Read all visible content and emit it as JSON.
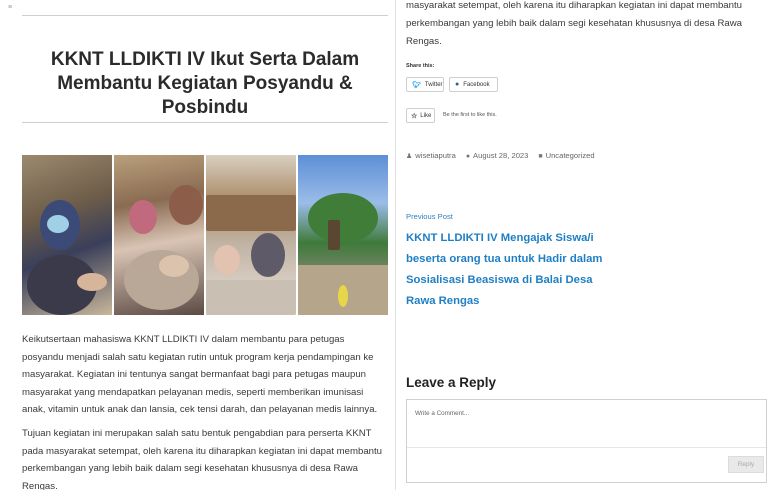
{
  "post": {
    "title": "KKNT LLDIKTI IV Ikut Serta Dalam Membantu Kegiatan Posyandu & Posbindu",
    "paragraph1": "Keikutsertaan mahasiswa KKNT LLDIKTI IV dalam membantu para petugas posyandu menjadi salah satu kegiatan rutin untuk program kerja pendampingan ke masyarakat. Kegiatan ini tentunya sangat bermanfaat bagi para petugas maupun masyarakat yang mendapatkan pelayanan medis, seperti memberikan imunisasi anak, vitamin untuk anak dan lansia, cek tensi darah, dan pelayanan medis lainnya.",
    "paragraph2": "Tujuan kegiatan ini merupakan salah satu bentuk pengabdian para perserta KKNT pada masyarakat setempat, oleh karena itu diharapkan kegiatan ini dapat membantu perkembangan yang lebih baik dalam segi kesehatan khususnya di desa Rawa Rengas.",
    "paragraph2_continued": "masyarakat setempat, oleh karena itu diharapkan kegiatan ini dapat membantu perkembangan yang lebih baik dalam segi kesehatan khususnya di desa Rawa Rengas."
  },
  "share": {
    "label": "Share this:",
    "twitter": "Twitter",
    "facebook": "Facebook"
  },
  "like": {
    "button": "Like",
    "text": "Be the first to like this."
  },
  "meta": {
    "author": "wisetiaputra",
    "date": "August 28, 2023",
    "category": "Uncategorized"
  },
  "navigation": {
    "previous_label": "Previous Post",
    "previous_title": "KKNT LLDIKTI IV Mengajak Siswa/i beserta orang tua untuk Hadir dalam Sosialisasi Beasiswa di Balai Desa Rawa Rengas"
  },
  "comments": {
    "heading": "Leave a Reply",
    "placeholder": "Write a Comment...",
    "reply_button": "Reply"
  }
}
